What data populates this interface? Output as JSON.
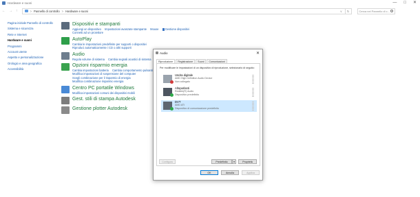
{
  "window": {
    "title": "Hardware e suoni",
    "controls": [
      "—",
      "□",
      "✕"
    ]
  },
  "nav": {
    "back": "←",
    "forward": "→",
    "up": "↑"
  },
  "addressbar": {
    "crumbs": [
      "Pannello di controllo",
      "Hardware e suoni"
    ],
    "separator": ">",
    "dropdown": "v",
    "refresh": "↻"
  },
  "search": {
    "placeholder": "Cerca nel Pannello di c..."
  },
  "leftnav": {
    "items": [
      {
        "label": "Pagina iniziale Pannello di controllo",
        "current": false
      },
      {
        "label": "Sistema e sicurezza",
        "current": false
      },
      {
        "label": "Rete e Internet",
        "current": false
      },
      {
        "label": "Hardware e suoni",
        "current": true
      },
      {
        "label": "Programmi",
        "current": false
      },
      {
        "label": "Account utente",
        "current": false
      },
      {
        "label": "Aspetto e personalizzazione",
        "current": false
      },
      {
        "label": "Orologio e area geografica",
        "current": false
      },
      {
        "label": "Accessibilità",
        "current": false
      }
    ]
  },
  "categories": [
    {
      "title": "Dispositivi e stampanti",
      "icon": "printer-icon",
      "color": "#5b6b7d",
      "links": [
        "Aggiungi un dispositivo",
        "Impostazioni avanzate stampante",
        "Mouse",
        "Gestione dispositivi"
      ],
      "links2": [
        "Connetti ad un proiettore"
      ]
    },
    {
      "title": "AutoPlay",
      "icon": "autoplay-icon",
      "color": "#2e9f4a",
      "links": [
        "Cambia le impostazioni predefinite per supporti o dispositivi"
      ],
      "links2": [
        "Riproduci automaticamente i CD o altri supporti"
      ]
    },
    {
      "title": "Audio",
      "icon": "speaker-icon",
      "color": "#6e7e8e",
      "links": [
        "Regola volume di sistema",
        "Cambia segnali acustici di sistema"
      ],
      "links2": []
    },
    {
      "title": "Opzioni risparmio energia",
      "icon": "power-icon",
      "color": "#3aa34f",
      "links": [
        "Cambia impostazioni batteria",
        "Cambia comportamento pulsanti di alimentazione"
      ],
      "links2": [
        "Modifica impostazioni di sospensione del computer",
        "Scegli combinazione per il risparmio di energia"
      ],
      "links3": [
        "Modifica combinazione risparmio energia"
      ]
    },
    {
      "title": "Centro PC portatile Windows",
      "icon": "mobility-icon",
      "color": "#4a8ad6",
      "links": [
        "Modifica impostazioni comuni dei dispositivi mobili"
      ],
      "links2": []
    },
    {
      "title": "Gest. stili di stampa Autodesk",
      "icon": "autodesk-plot-icon",
      "color": "#7d7d7d",
      "links": [],
      "links2": []
    },
    {
      "title": "Gestione plotter Autodesk",
      "icon": "plotter-icon",
      "color": "#8a8a8a",
      "links": [],
      "links2": []
    }
  ],
  "dialog": {
    "title": "Audio",
    "close": "✕",
    "tabs": [
      "Riproduzione",
      "Registrazione",
      "Suoni",
      "Comunicazioni"
    ],
    "active_tab": 0,
    "instruction": "Per modificare le impostazioni di un dispositivo di riproduzione, selezionarlo di seguito:",
    "devices": [
      {
        "name": "Uscita digitale",
        "sub1": "AMD High Definition Audio Device",
        "sub2": "Non collegato",
        "status": "not-connected",
        "selected": false
      },
      {
        "name": "Altoparlanti",
        "sub1": "Realtek(R) Audio",
        "sub2": "Dispositivo predefinito",
        "status": "default",
        "selected": false
      },
      {
        "name": "DVT",
        "sub1": "AMD ATI",
        "sub2": "Dispositivo di comunicazione predefinito",
        "status": "default",
        "selected": true
      }
    ],
    "buttons": {
      "configure": "Configura",
      "set_default": "Predefinito",
      "properties": "Proprietà",
      "ok": "OK",
      "cancel": "Annulla",
      "apply": "Applica"
    }
  }
}
